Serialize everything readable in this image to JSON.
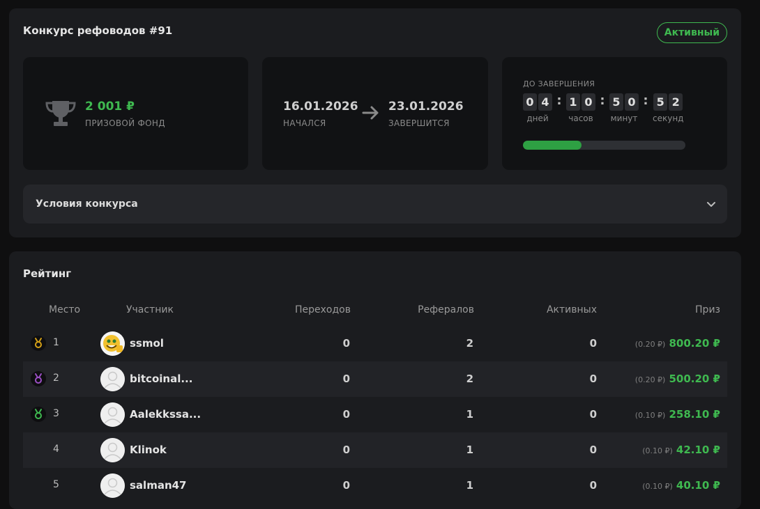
{
  "contest": {
    "title": "Конкурс рефоводов #91",
    "status": "Активный",
    "prize_value": "2 001 ₽",
    "prize_label": "ПРИЗОВОЙ ФОНД",
    "start_date": "16.01.2026",
    "start_label": "НАЧАЛСЯ",
    "end_date": "23.01.2026",
    "end_label": "ЗАВЕРШИТСЯ",
    "until_label": "ДО ЗАВЕРШЕНИЯ",
    "timer": {
      "days": [
        "0",
        "4"
      ],
      "hours": [
        "1",
        "0"
      ],
      "minutes": [
        "5",
        "0"
      ],
      "seconds": [
        "5",
        "2"
      ],
      "days_label": "дней",
      "hours_label": "часов",
      "minutes_label": "минут",
      "seconds_label": "секунд"
    },
    "progress_fraction": 0.36,
    "conditions_label": "Условия конкурса"
  },
  "colors": {
    "accent": "#3fb950",
    "gold": "#d4a017",
    "silver": "#9b4fc4",
    "bronze": "#3fb950"
  },
  "rating": {
    "title": "Рейтинг",
    "columns": {
      "place": "Место",
      "participant": "Участник",
      "clicks": "Переходов",
      "referrals": "Рефералов",
      "active": "Активных",
      "prize": "Приз"
    },
    "rows": [
      {
        "place": "1",
        "name": "ssmol",
        "clicks": "0",
        "referrals": "2",
        "active": "0",
        "extra": "(0.20 ₽)",
        "prize": "800.20 ₽"
      },
      {
        "place": "2",
        "name": "bitcoinal...",
        "clicks": "0",
        "referrals": "2",
        "active": "0",
        "extra": "(0.20 ₽)",
        "prize": "500.20 ₽"
      },
      {
        "place": "3",
        "name": "Aalekkssa...",
        "clicks": "0",
        "referrals": "1",
        "active": "0",
        "extra": "(0.10 ₽)",
        "prize": "258.10 ₽"
      },
      {
        "place": "4",
        "name": "Klinok",
        "clicks": "0",
        "referrals": "1",
        "active": "0",
        "extra": "(0.10 ₽)",
        "prize": "42.10 ₽"
      },
      {
        "place": "5",
        "name": "salman47",
        "clicks": "0",
        "referrals": "1",
        "active": "0",
        "extra": "(0.10 ₽)",
        "prize": "40.10 ₽"
      }
    ]
  }
}
